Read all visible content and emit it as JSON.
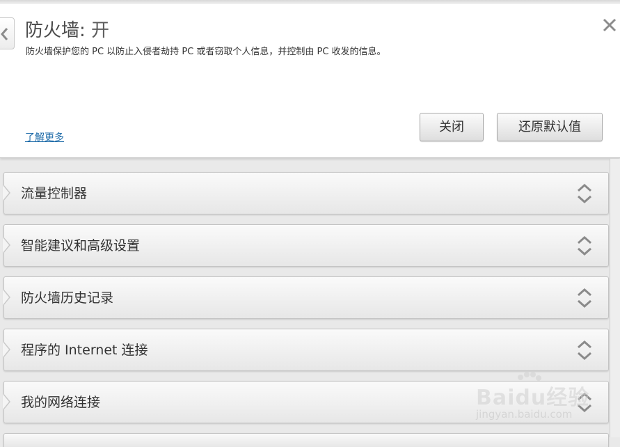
{
  "header": {
    "title": "防火墙",
    "title_separator": ": ",
    "status": "开",
    "description": "防火墙保护您的 PC 以防止入侵者劫持 PC 或者窃取个人信息，并控制由 PC 收发的信息。",
    "learn_more": "了解更多",
    "buttons": {
      "close_label": "关闭",
      "restore_label": "还原默认值"
    }
  },
  "sections": [
    {
      "label": "流量控制器"
    },
    {
      "label": "智能建议和高级设置"
    },
    {
      "label": "防火墙历史记录"
    },
    {
      "label": "程序的 Internet 连接"
    },
    {
      "label": "我的网络连接"
    }
  ],
  "watermark": {
    "brand": "Baidu经验",
    "url": "jingyan.baidu.com"
  },
  "icons": {
    "back": "chevron-left-icon",
    "close": "close-icon",
    "expand": "expand-collapse-icon"
  }
}
